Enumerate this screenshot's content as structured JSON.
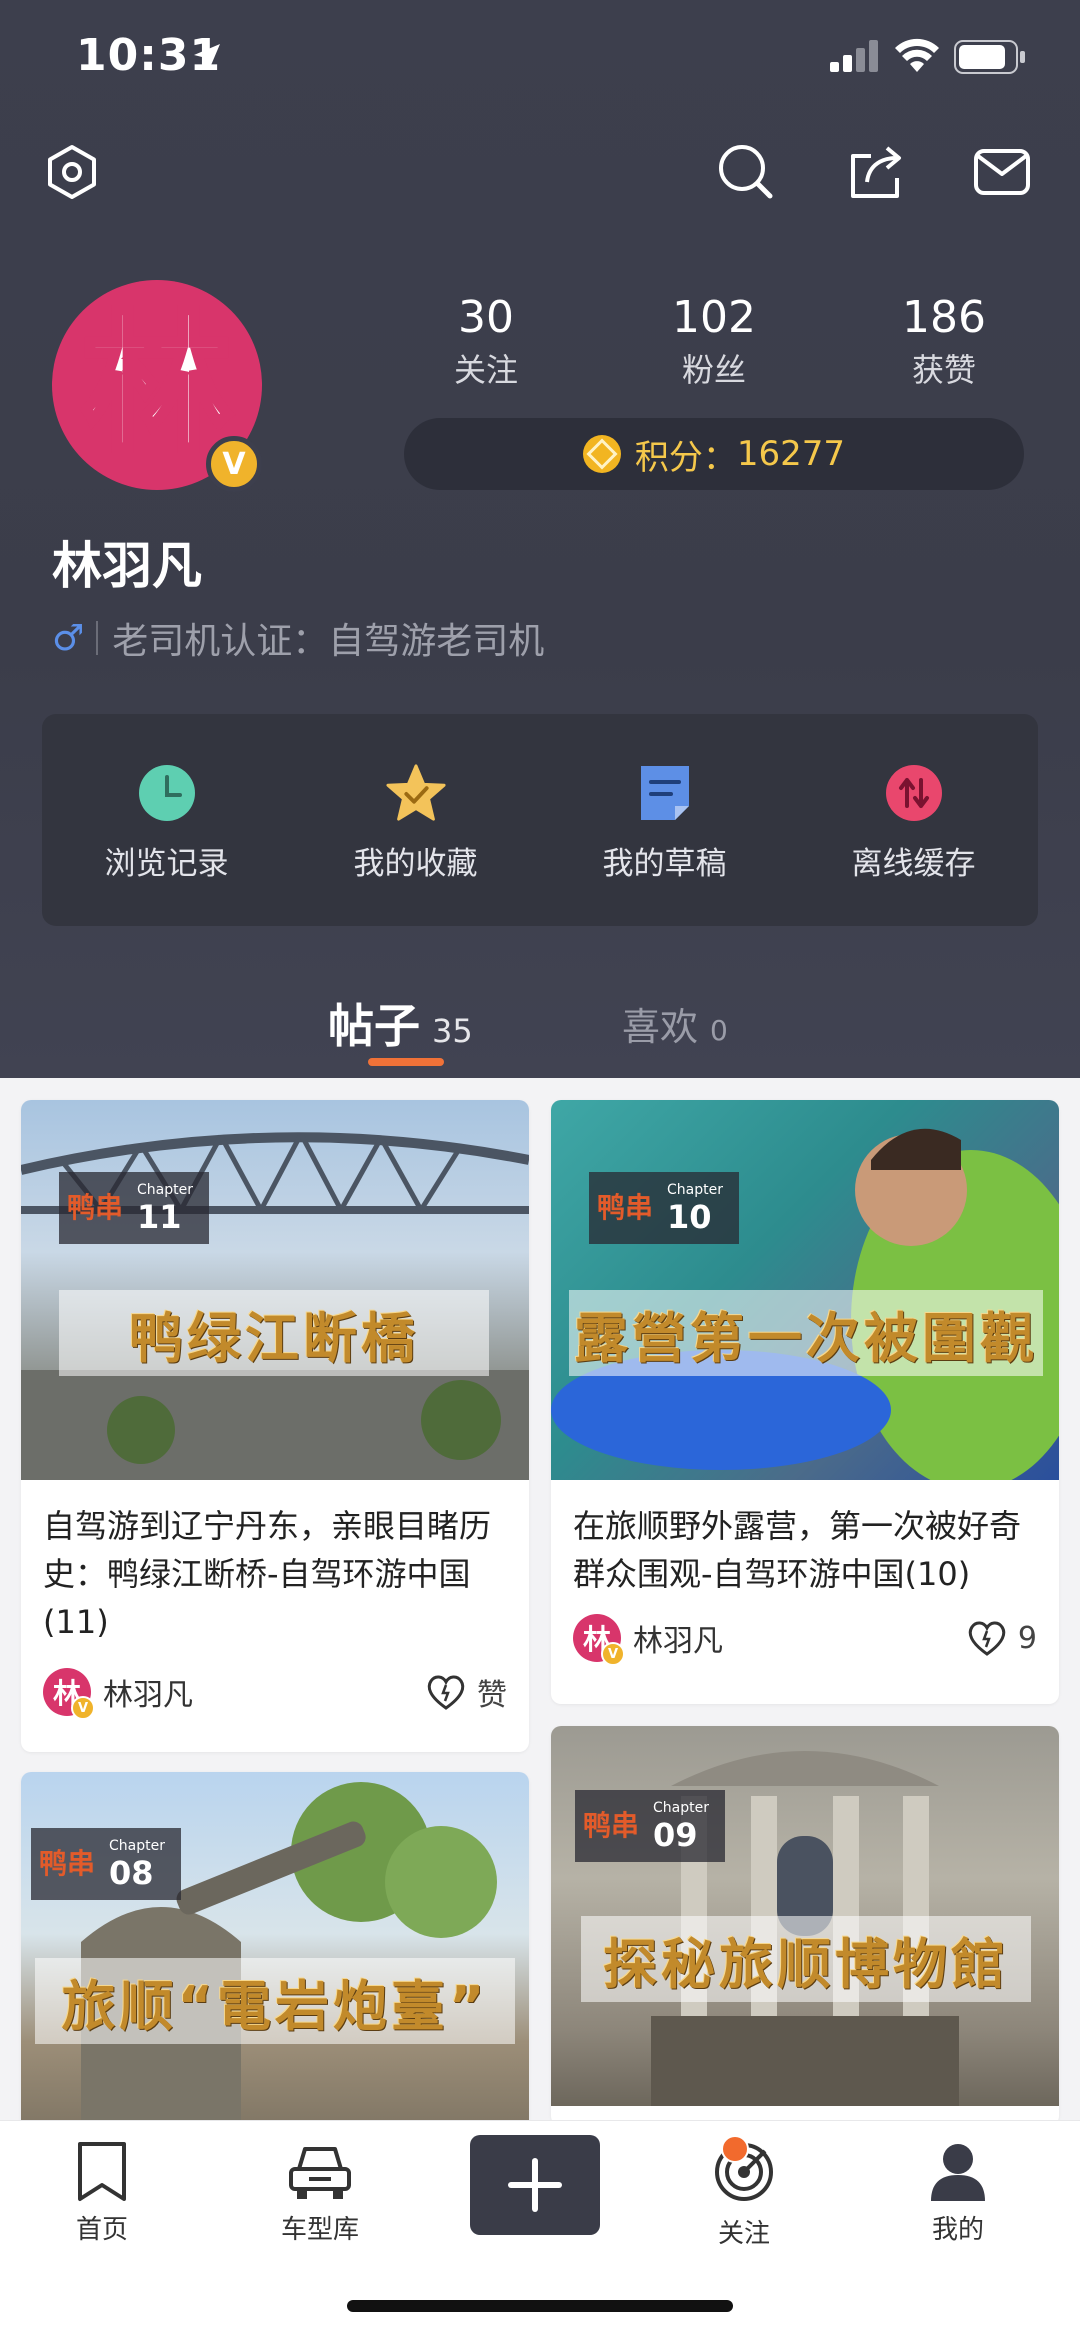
{
  "status_bar": {
    "time": "10:31"
  },
  "profile": {
    "avatar_char": "林",
    "verified_mark": "V",
    "name": "林羽凡",
    "gender_symbol": "♂",
    "certification": "老司机认证：自驾游老司机",
    "stats": [
      {
        "value": "30",
        "label": "关注"
      },
      {
        "value": "102",
        "label": "粉丝"
      },
      {
        "value": "186",
        "label": "获赞"
      }
    ],
    "points_label": "积分：",
    "points_value": "16277"
  },
  "quick_actions": [
    {
      "label": "浏览记录",
      "icon": "clock-icon",
      "color": "#5ecfb1"
    },
    {
      "label": "我的收藏",
      "icon": "star-icon",
      "color": "#f3c35a"
    },
    {
      "label": "我的草稿",
      "icon": "draft-icon",
      "color": "#5d8fe6"
    },
    {
      "label": "离线缓存",
      "icon": "offline-cache-icon",
      "color": "#e9476d"
    }
  ],
  "tabs": [
    {
      "label": "帖子",
      "count": "35",
      "active": true
    },
    {
      "label": "喜欢",
      "count": "0",
      "active": false
    }
  ],
  "posts": [
    {
      "title": "自驾游到辽宁丹东，亲眼目睹历史：鸭绿江断桥-自驾环游中国(11)",
      "banner": "鸭绿江断橋",
      "chapter": "11",
      "author": "林羽凡",
      "likes": "赞"
    },
    {
      "title": "在旅顺野外露营，第一次被好奇群众围观-自驾环游中国(10)",
      "banner": "露營第一次被圍觀",
      "chapter": "10",
      "author": "林羽凡",
      "likes": "9"
    },
    {
      "title": "",
      "banner": "旅顺“電岩炮臺”",
      "chapter": "08",
      "author": "",
      "likes": ""
    },
    {
      "title": "",
      "banner": "探秘旅顺博物館",
      "chapter": "09",
      "author": "",
      "likes": ""
    }
  ],
  "chapter_label": "Chapter",
  "logo_text": "鸭串",
  "bottom_nav": [
    {
      "label": "首页",
      "icon": "bookmark-icon"
    },
    {
      "label": "车型库",
      "icon": "car-icon"
    },
    {
      "label": "",
      "icon": "plus-icon"
    },
    {
      "label": "关注",
      "icon": "target-icon"
    },
    {
      "label": "我的",
      "icon": "user-icon"
    }
  ],
  "colors": {
    "header_bg": "#3d3f4d",
    "accent_orange": "#f07238",
    "points_gold": "#f5c84b",
    "avatar_pink": "#d8356b"
  }
}
